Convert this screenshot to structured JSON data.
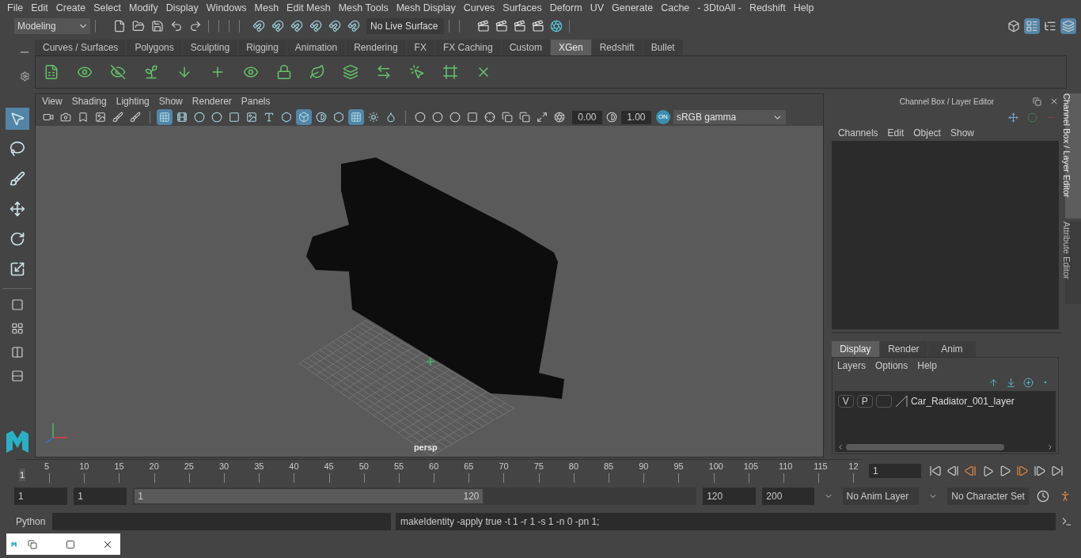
{
  "menu_bar": [
    "File",
    "Edit",
    "Create",
    "Select",
    "Modify",
    "Display",
    "Windows",
    "Mesh",
    "Edit Mesh",
    "Mesh Tools",
    "Mesh Display",
    "Curves",
    "Surfaces",
    "Deform",
    "UV",
    "Generate",
    "Cache",
    "- 3DtoAll -",
    "Redshift",
    "Help"
  ],
  "status_line": {
    "mode": "Modeling",
    "live_surface": "No Live Surface"
  },
  "workspace_buttons": [
    {
      "on": false
    },
    {
      "on": true
    },
    {
      "on": false
    },
    {
      "on": true
    }
  ],
  "shelf_tabs": [
    {
      "label": "Curves / Surfaces",
      "selected": false
    },
    {
      "label": "Polygons",
      "selected": false
    },
    {
      "label": "Sculpting",
      "selected": false
    },
    {
      "label": "Rigging",
      "selected": false
    },
    {
      "label": "Animation",
      "selected": false
    },
    {
      "label": "Rendering",
      "selected": false
    },
    {
      "label": "FX",
      "selected": false
    },
    {
      "label": "FX Caching",
      "selected": false
    },
    {
      "label": "Custom",
      "selected": false
    },
    {
      "label": "XGen",
      "selected": true
    },
    {
      "label": "Redshift",
      "selected": false
    },
    {
      "label": "Bullet",
      "selected": false
    }
  ],
  "tools": [
    {
      "selected": true
    },
    {
      "selected": false
    },
    {
      "selected": false
    },
    {
      "selected": false
    },
    {
      "selected": false
    },
    {
      "selected": false
    }
  ],
  "viewport": {
    "menus": [
      "View",
      "Shading",
      "Lighting",
      "Show",
      "Renderer",
      "Panels"
    ],
    "toggles": [
      {
        "on": true
      },
      {
        "on": false
      },
      {
        "on": false
      },
      {
        "on": false
      },
      {
        "on": false
      },
      {
        "on": false
      },
      {
        "on": false
      },
      {
        "on": false
      },
      {
        "on": true
      },
      {
        "on": false
      },
      {
        "on": false
      },
      {
        "on": true
      },
      {
        "on": false
      },
      {
        "on": false
      }
    ],
    "exposure": "0.00",
    "gamma": "1.00",
    "color_management": "ON",
    "color_space": "sRGB gamma",
    "camera": "persp"
  },
  "channel_box": {
    "title": "Channel Box / Layer Editor",
    "menus": [
      "Channels",
      "Edit",
      "Object",
      "Show"
    ],
    "tabs": [
      {
        "label": "Display",
        "selected": true
      },
      {
        "label": "Render",
        "selected": false
      },
      {
        "label": "Anim",
        "selected": false
      }
    ],
    "layer_menus": [
      "Layers",
      "Options",
      "Help"
    ],
    "layers": [
      {
        "visibility": "V",
        "playback": "P",
        "name": "Car_Radiator_001_layer"
      }
    ]
  },
  "side_tabs": [
    {
      "label": "Channel Box / Layer Editor",
      "selected": true
    },
    {
      "label": "Attribute Editor",
      "selected": false
    }
  ],
  "timeline": {
    "current_frame_marker": "1",
    "ticks": [
      "5",
      "10",
      "15",
      "20",
      "25",
      "30",
      "35",
      "40",
      "45",
      "50",
      "55",
      "60",
      "65",
      "70",
      "75",
      "80",
      "85",
      "90",
      "95",
      "100",
      "105",
      "110",
      "115",
      "12"
    ],
    "current_frame": "1",
    "level": 0
  },
  "range": {
    "start": "1",
    "playback_start": "1",
    "slider_start": "1",
    "slider_end": "120",
    "playback_end": "120",
    "end": "200",
    "level": 0.61,
    "anim_layer": "No Anim Layer",
    "character_set": "No Character Set"
  },
  "command_line": {
    "language": "Python",
    "result": "makeIdentity -apply true -t 1 -r 1 -s 1 -n 0 -pn 1;"
  }
}
